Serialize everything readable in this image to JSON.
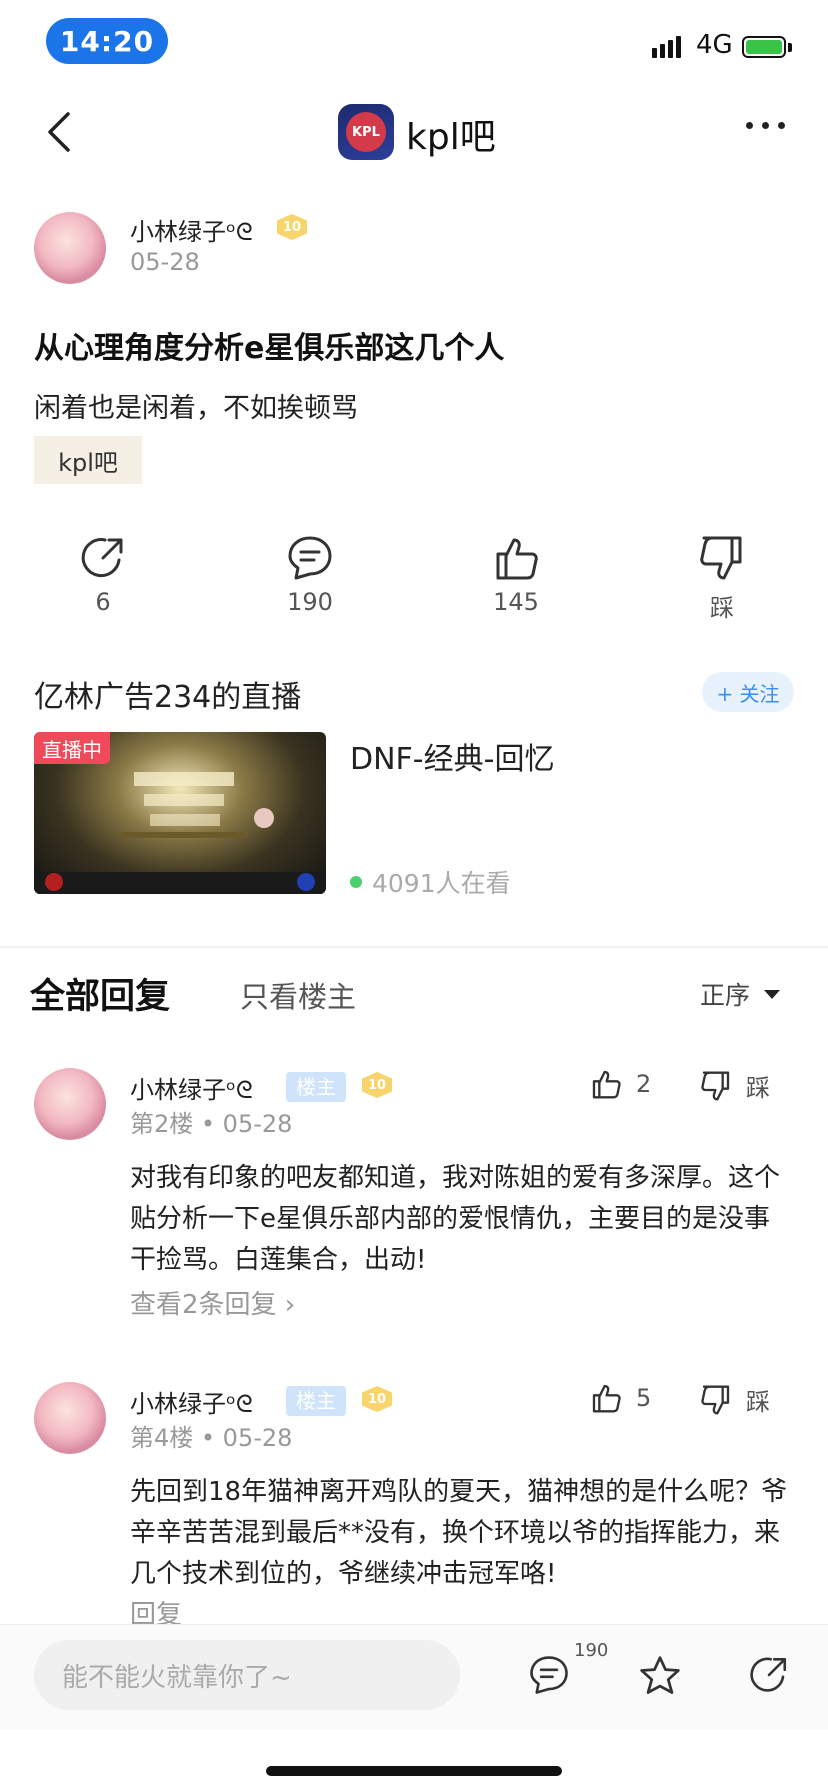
{
  "status": {
    "time": "14:20",
    "network": "4G"
  },
  "nav": {
    "title": "kpl吧",
    "icon_text": "KPL"
  },
  "post": {
    "author": "小林绿子ᵒᘓ",
    "level": "10",
    "date": "05-28",
    "title": "从心理角度分析e星俱乐部这几个人",
    "body": "闲着也是闲着，不如挨顿骂",
    "forum_tag": "kpl吧"
  },
  "actions": [
    {
      "icon": "share-icon",
      "label": "6"
    },
    {
      "icon": "comment-icon",
      "label": "190"
    },
    {
      "icon": "thumbs-up-icon",
      "label": "145"
    },
    {
      "icon": "thumbs-down-icon",
      "label": "踩"
    }
  ],
  "live": {
    "title": "亿林广告234的直播",
    "follow_label": "+ 关注",
    "badge": "直播中",
    "name": "DNF-经典-回忆",
    "viewers": "4091人在看"
  },
  "tabs": {
    "all": "全部回复",
    "owner_only": "只看楼主",
    "sort": "正序"
  },
  "replies": [
    {
      "author": "小林绿子ᵒᘓ",
      "owner_tag": "楼主",
      "level": "10",
      "meta": "第2楼 • 05-28",
      "likes": "2",
      "dislike": "踩",
      "text": "对我有印象的吧友都知道，我对陈姐的爱有多深厚。这个贴分析一下e星俱乐部内部的爱恨情仇，主要目的是没事干捡骂。白莲集合，出动!",
      "more": "查看2条回复 ›"
    },
    {
      "author": "小林绿子ᵒᘓ",
      "owner_tag": "楼主",
      "level": "10",
      "meta": "第4楼 • 05-28",
      "likes": "5",
      "dislike": "踩",
      "text": "先回到18年猫神离开鸡队的夏天，猫神想的是什么呢？爷辛辛苦苦混到最后**没有，换个环境以爷的指挥能力，来几个技术到位的，爷继续冲击冠军咯!",
      "more": "回复"
    }
  ],
  "bottom": {
    "placeholder": "能不能火就靠你了~",
    "comment_count": "190"
  }
}
